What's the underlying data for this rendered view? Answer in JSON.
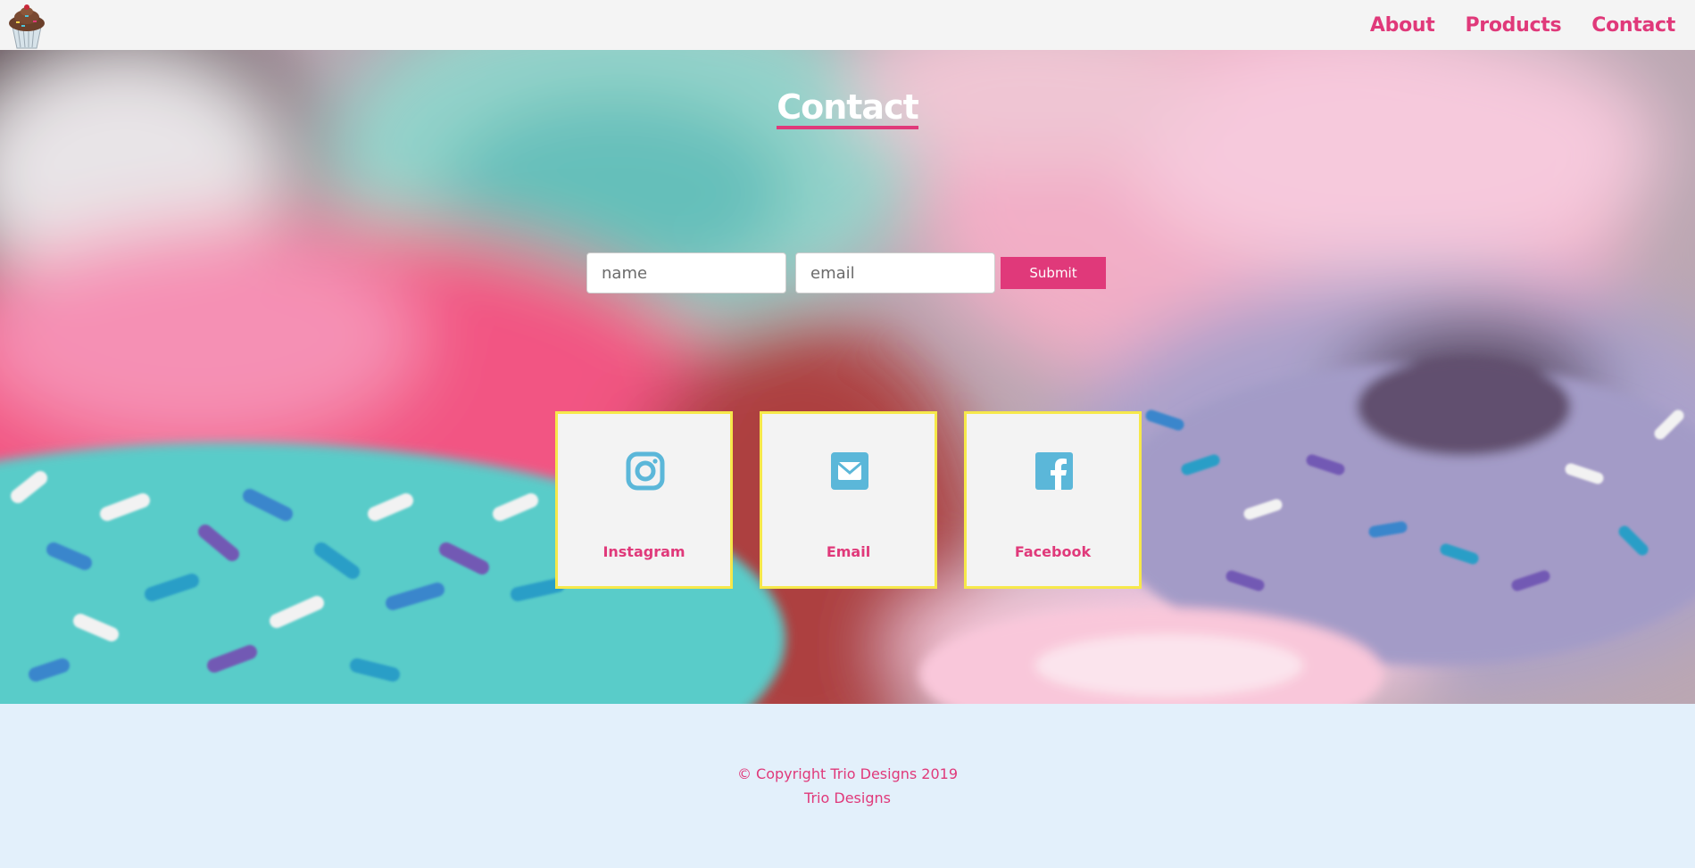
{
  "nav": {
    "logo_icon": "cupcake-icon",
    "links": [
      "About",
      "Products",
      "Contact"
    ]
  },
  "hero": {
    "title": "Contact",
    "form": {
      "name_placeholder": "name",
      "email_placeholder": "email",
      "submit_label": "Submit"
    },
    "cards": [
      {
        "icon": "instagram-icon",
        "label": "Instagram"
      },
      {
        "icon": "envelope-icon",
        "label": "Email"
      },
      {
        "icon": "facebook-icon",
        "label": "Facebook"
      }
    ]
  },
  "footer": {
    "copyright": "© Copyright Trio Designs 2019",
    "company": "Trio Designs"
  },
  "colors": {
    "accent": "#e0397a",
    "icon": "#5bb7d9",
    "card_border": "#f6e84a",
    "card_bg": "#f3f3f3",
    "footer_bg": "#e3f0fb",
    "nav_bg": "#f4f4f4"
  }
}
